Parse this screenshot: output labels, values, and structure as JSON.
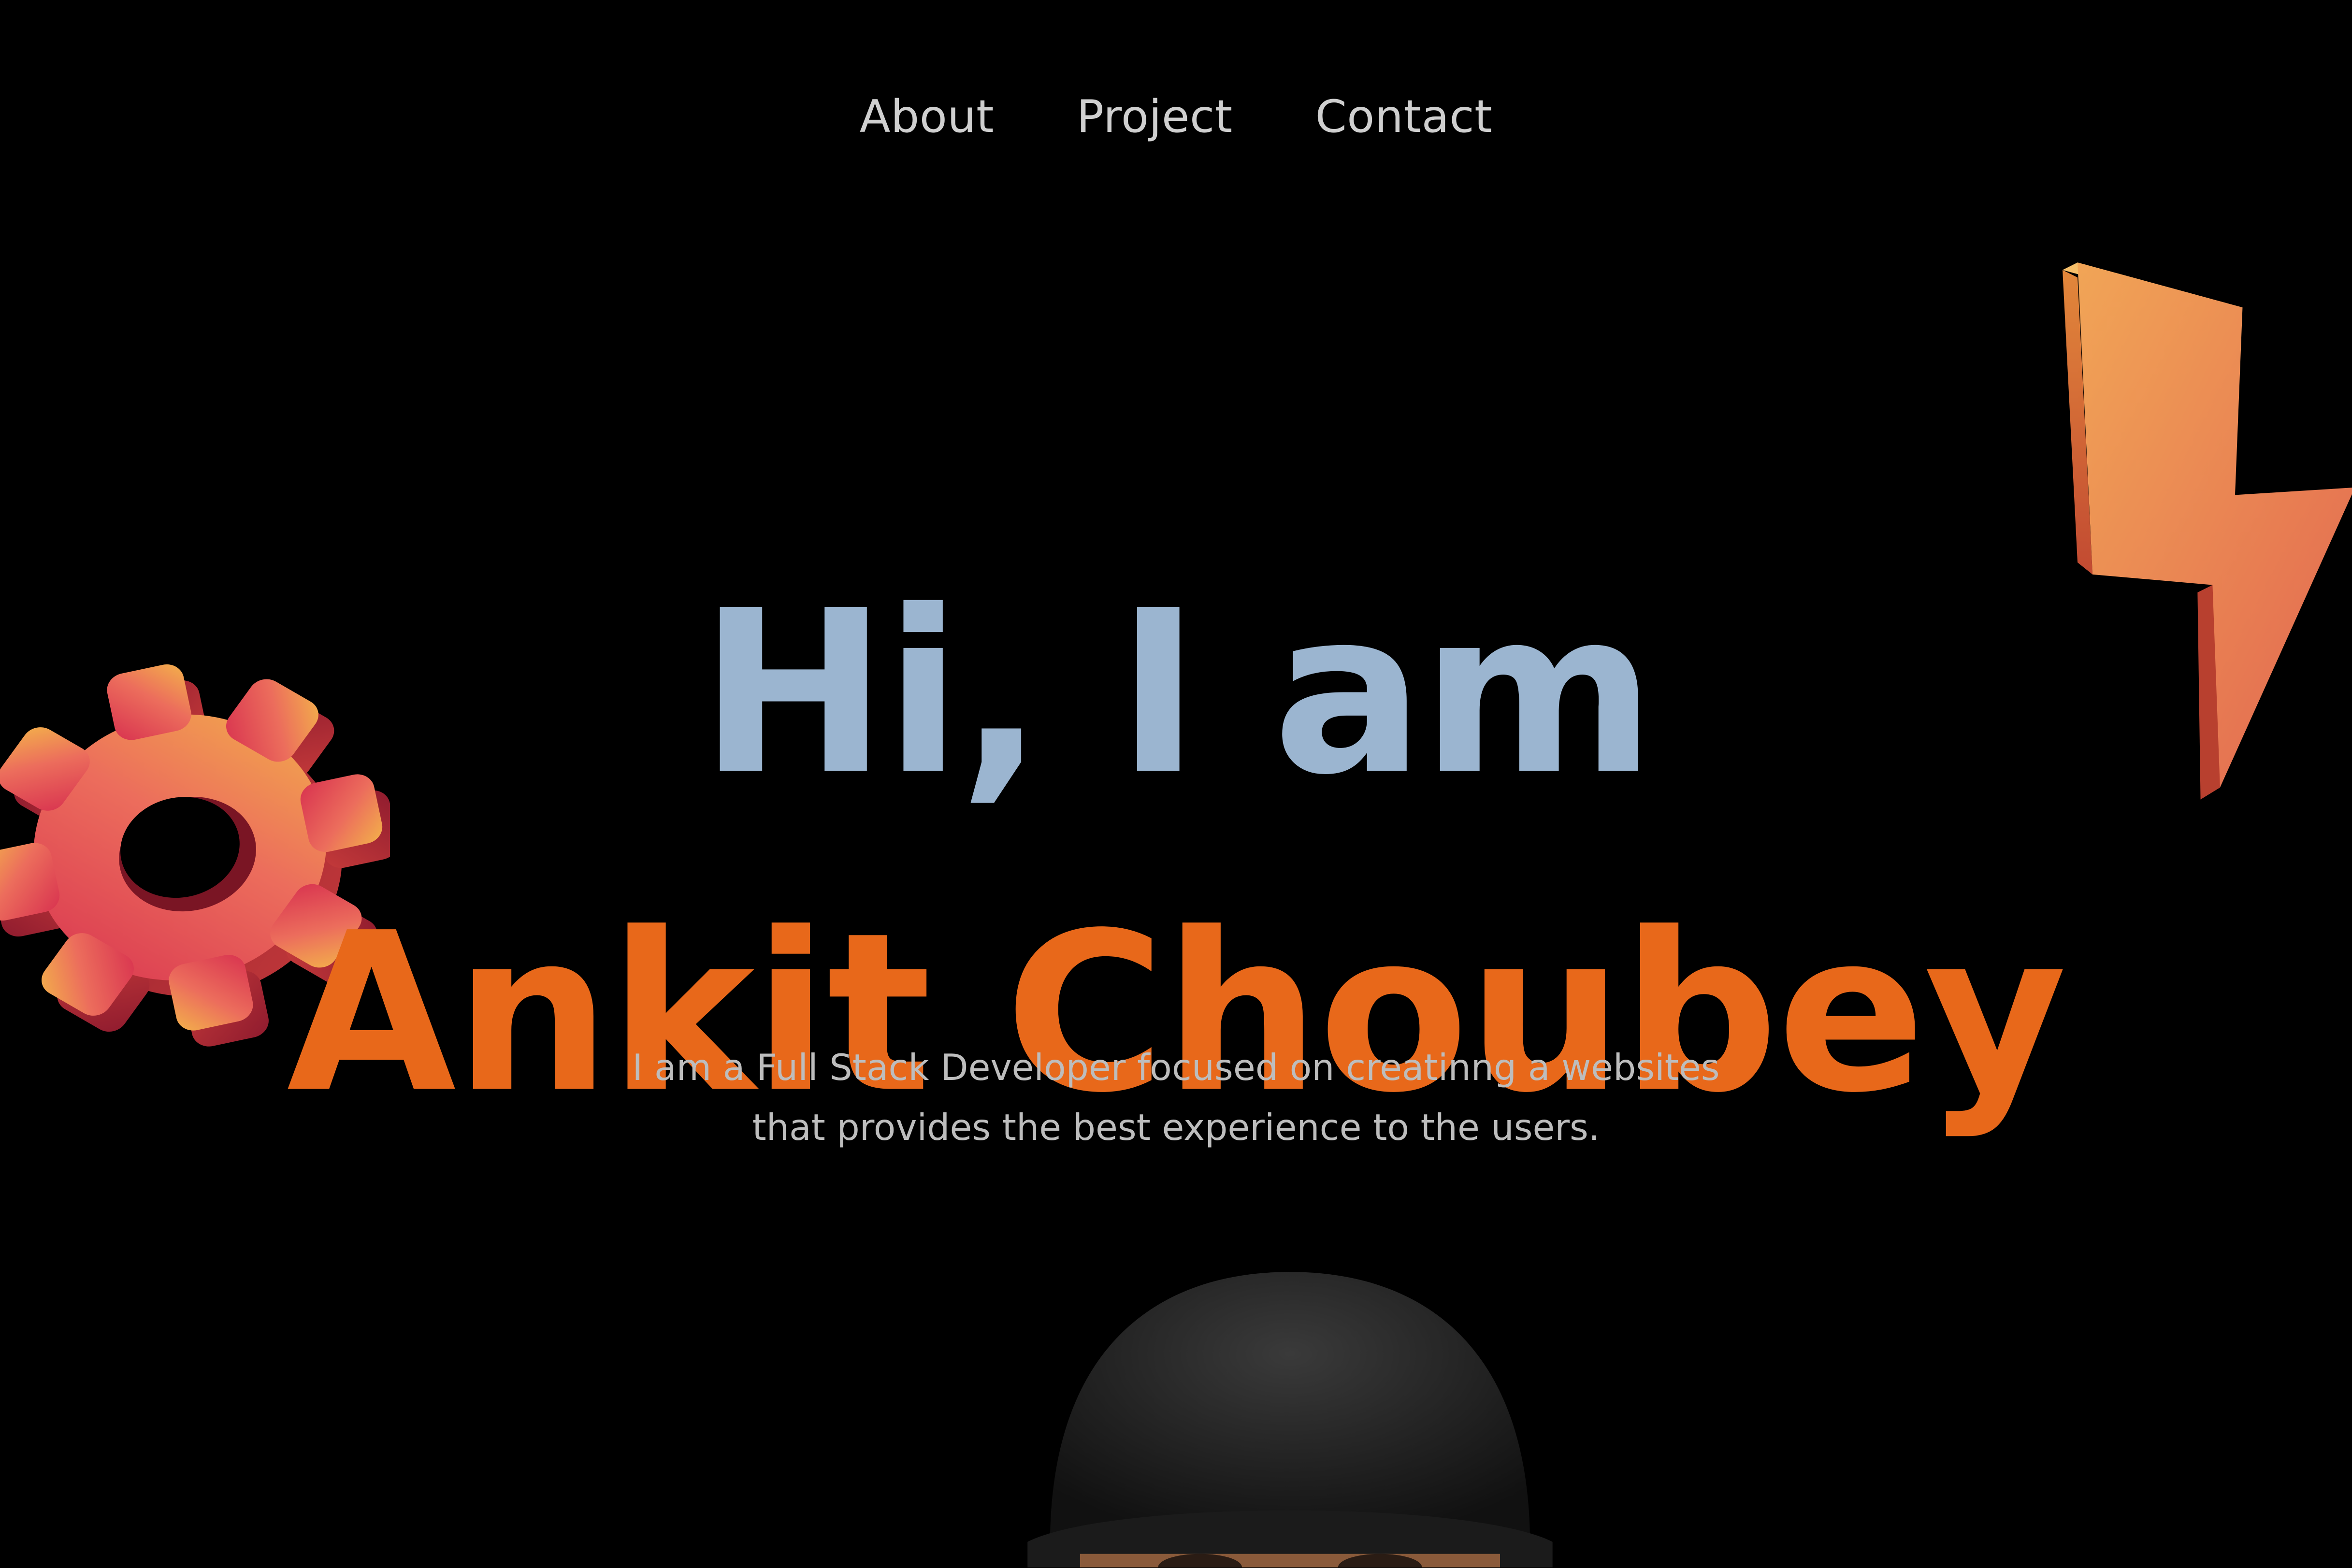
{
  "nav": {
    "items": [
      {
        "label": "About"
      },
      {
        "label": "Project"
      },
      {
        "label": "Contact"
      }
    ]
  },
  "hero": {
    "greeting": "Hi, I am",
    "name": "Ankit Choubey",
    "description_line1": "I am a Full Stack Developer focused on creatinng a websites",
    "description_line2": "that provides the best experience to the users."
  },
  "colors": {
    "background": "#000000",
    "greeting": "#9bb5d0",
    "name": "#e8681a",
    "nav_text": "#cfcfcf",
    "description": "#bdbdbd"
  },
  "decor": {
    "left_icon": "gear-icon",
    "right_icon": "lightning-bolt-icon",
    "bottom_image": "memoji-avatar"
  }
}
